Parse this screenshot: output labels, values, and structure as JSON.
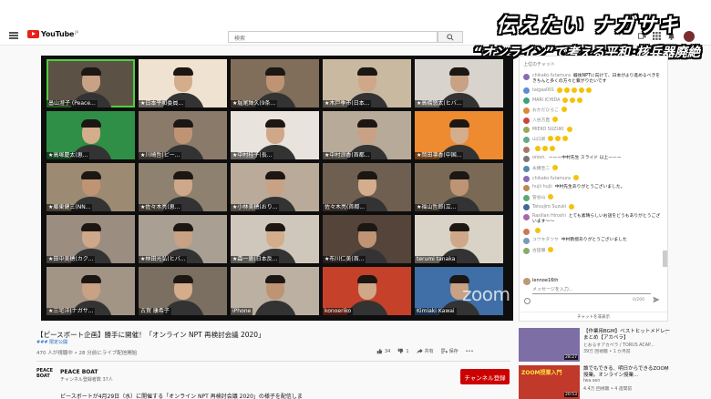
{
  "header": {
    "logo_text": "YouTube",
    "logo_region": "JP",
    "search_placeholder": "検索"
  },
  "overlay": {
    "line1": "伝えたい ナガサキ",
    "line2": "“オンライン”で考える平和･核兵器廃絶"
  },
  "video": {
    "zoom_watermark": "zoom",
    "participants": [
      {
        "name": "畠山澄子 (Peace...",
        "bg": "#5b5145",
        "highlight": true,
        "logo": "PEACE BOAT"
      },
      {
        "name": "★日本平和委員...",
        "bg": "#f0e2d0",
        "highlight": false
      },
      {
        "name": "★堀尾輝久(9条...",
        "bg": "#806e5b",
        "highlight": false
      },
      {
        "name": "★木戸季市(日本...",
        "bg": "#c9b9a0",
        "highlight": false
      },
      {
        "name": "★高橋悠太(ヒバ...",
        "bg": "#d8d3cc",
        "highlight": false
      },
      {
        "name": "★高塚慶太(恵...",
        "bg": "#2f8f46",
        "highlight": false
      },
      {
        "name": "★川崎哲(ピー...",
        "bg": "#8a7a6a",
        "highlight": false
      },
      {
        "name": "★中村桂子(長...",
        "bg": "#e8e3dc",
        "highlight": false
      },
      {
        "name": "★中村涼香(首都...",
        "bg": "#b7aa98",
        "highlight": false
      },
      {
        "name": "★岡田凛香(中国...",
        "bg": "#ee8a30",
        "highlight": false
      },
      {
        "name": "★藤東健三(NN...",
        "bg": "#9c8a72",
        "highlight": false
      },
      {
        "name": "★佐々木亮(恵...",
        "bg": "#8e8170",
        "highlight": false
      },
      {
        "name": "★小林美穂(おり...",
        "bg": "#b9aa99",
        "highlight": false
      },
      {
        "name": "佐々木亮(首都...",
        "bg": "#6f5f50",
        "highlight": false
      },
      {
        "name": "★福山哲郎(立...",
        "bg": "#7a6a55",
        "highlight": false
      },
      {
        "name": "★田中美穂(カク...",
        "bg": "#9b8d80",
        "highlight": false
      },
      {
        "name": "★林田光弘(ヒバ...",
        "bg": "#a99f93",
        "highlight": false
      },
      {
        "name": "★森一恵(日本反...",
        "bg": "#cfc7bb",
        "highlight": false
      },
      {
        "name": "★布川仁美(首...",
        "bg": "#54443a",
        "highlight": false
      },
      {
        "name": "terumi tanaka",
        "bg": "#d9d2c6",
        "highlight": false
      },
      {
        "name": "★三宅洋(ナガサ...",
        "bg": "#a29586",
        "highlight": false
      },
      {
        "name": "古賀 康希子",
        "bg": "#7b6f61",
        "highlight": false
      },
      {
        "name": "iPhone",
        "bg": "#bcb0a2",
        "highlight": false
      },
      {
        "name": "konoeriko",
        "bg": "#c6412a",
        "highlight": false
      },
      {
        "name": "Kimiaki Kawai",
        "bg": "#3f6fa6",
        "highlight": false
      }
    ]
  },
  "info": {
    "title": "【ピースボート企画】勝手に開催！「オンライン NPT 再検討会議 2020」",
    "tags": "### 限定公開",
    "stats": "470 人が視聴中 • 28 分前にライブ配信開始",
    "likes": "34",
    "dislikes": "1",
    "share_label": "共有",
    "save_label": "保存",
    "more_label": "•••"
  },
  "channel": {
    "logo": "PEACE BOAT",
    "name": "PEACE BOAT",
    "subs": "チャンネル登録者数 37人",
    "subscribe_label": "チャンネル登録",
    "description": "ピースボートが4月29日（水）に開催する「オンライン NPT 再検討会議 2020」の様子を配信しま"
  },
  "chat": {
    "top_label": "上位のチャット",
    "messages": [
      {
        "author": "chikako futamura",
        "text": "戦後NPTに向けて、日本がより進めるべきをきちんと多くの方々と繋がりたいです",
        "claps": 0,
        "color": "#8b6bb1"
      },
      {
        "author": "taigaa001",
        "text": "",
        "claps": 5,
        "color": "#5c8dd6"
      },
      {
        "author": "MARI ICHIDA",
        "text": "",
        "claps": 3,
        "color": "#3aa37a"
      },
      {
        "author": "おかだひろこ",
        "text": "",
        "claps": 1,
        "color": "#d98b3a"
      },
      {
        "author": "入谷方直",
        "text": "",
        "claps": 1,
        "color": "#c44"
      },
      {
        "author": "MIEKO SUZUKI",
        "text": "",
        "claps": 1,
        "color": "#9a5"
      },
      {
        "author": "山口新",
        "text": "",
        "claps": 3,
        "color": "#6a8"
      },
      {
        "author": "",
        "text": "",
        "claps": 3,
        "color": "#a76"
      },
      {
        "author": "onion.",
        "text": "ーーー中村先生 スライド 以上ーーー",
        "claps": 0,
        "color": "#777"
      },
      {
        "author": "永橋圭二",
        "text": "",
        "claps": 1,
        "color": "#58a"
      },
      {
        "author": "chikako futamura",
        "text": "",
        "claps": 1,
        "color": "#8b6bb1"
      },
      {
        "author": "hujii hujii",
        "text": "中村先生ありがとうございました。",
        "claps": 0,
        "color": "#b85"
      },
      {
        "author": "管谷山",
        "text": "",
        "claps": 1,
        "color": "#5a7"
      },
      {
        "author": "Tatsujiro Suzuki",
        "text": "",
        "claps": 1,
        "color": "#469"
      },
      {
        "author": "Rasilian Hiroshi",
        "text": "とても素晴らしいお話をどうもありがとうございます〜〜",
        "claps": 0,
        "color": "#a6a"
      },
      {
        "author": "",
        "text": "",
        "claps": 1,
        "color": "#c75"
      },
      {
        "author": "ユウキタツヤ",
        "text": "中村教授ありがとうございました",
        "claps": 0,
        "color": "#79b"
      },
      {
        "author": "古田徹",
        "text": "",
        "claps": 1,
        "color": "#8a6"
      }
    ],
    "input_user": "lennoe16th",
    "input_placeholder": "メッセージを入力...",
    "counter": "0/200",
    "hide_label": "チャットを非表示"
  },
  "related": [
    {
      "title": "【作業用BGM】ベストヒットメドレーまとめ【アカペラ】",
      "channel": "とおるすアカペラ / TORUS ACAP...",
      "meta": "39万 回視聴 • 1 か月前",
      "duration": "28:27",
      "bg": "#7d6fa6"
    },
    {
      "title": "誰でもできる、明日からできるZOOM授業。オンライン授業...",
      "channel": "Iwa sen",
      "meta": "4.4万 回視聴 • 4 週間前",
      "duration": "20:53",
      "bg": "#c0392b",
      "badge": "ZOOM授業入門"
    }
  ]
}
